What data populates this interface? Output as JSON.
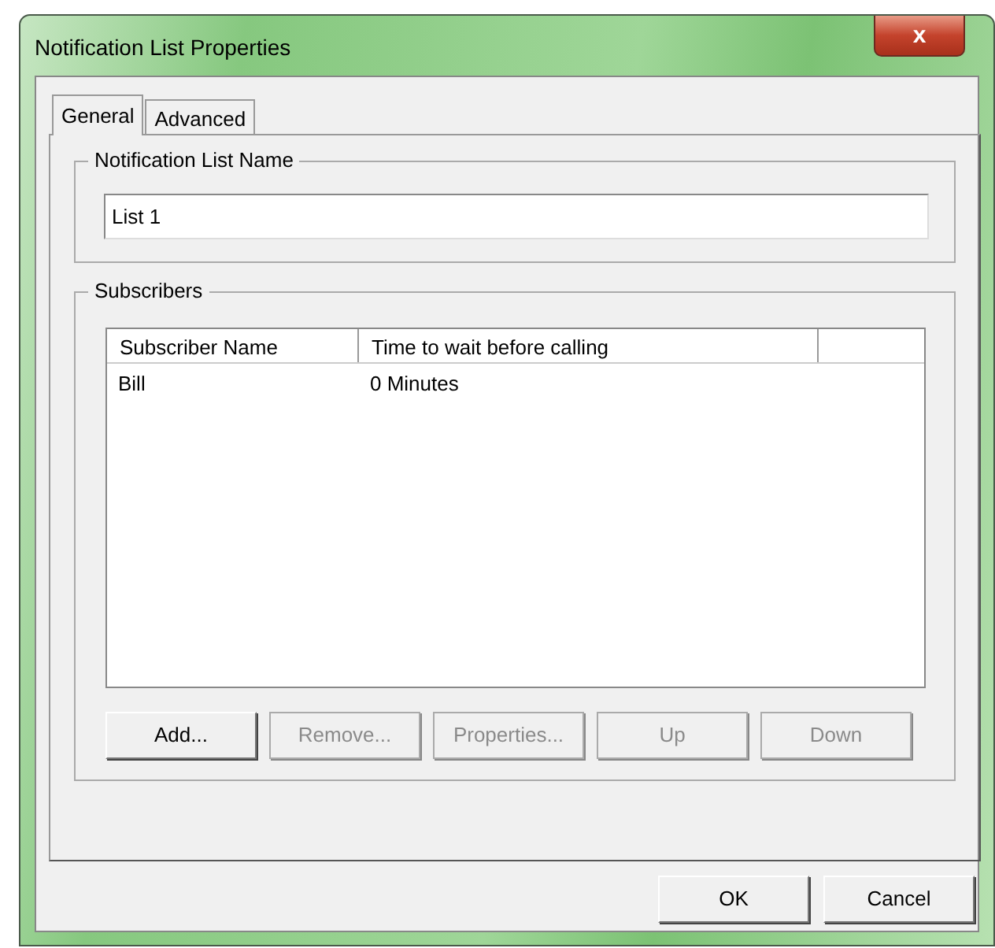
{
  "window": {
    "title": "Notification List Properties",
    "close": "x"
  },
  "tabs": [
    {
      "label": "General",
      "selected": true
    },
    {
      "label": "Advanced",
      "selected": false
    }
  ],
  "name_group": {
    "title": "Notification List Name",
    "value": "List 1"
  },
  "subscribers": {
    "title": "Subscribers",
    "columns": [
      "Subscriber Name",
      "Time to wait before calling"
    ],
    "rows": [
      [
        "Bill",
        "0 Minutes"
      ]
    ],
    "buttons": [
      {
        "label": "Add...",
        "disabled": false
      },
      {
        "label": "Remove...",
        "disabled": true
      },
      {
        "label": "Properties...",
        "disabled": true
      },
      {
        "label": "Up",
        "disabled": true
      },
      {
        "label": "Down",
        "disabled": true
      }
    ]
  },
  "buttons": [
    {
      "label": "OK"
    },
    {
      "label": "Cancel"
    }
  ]
}
